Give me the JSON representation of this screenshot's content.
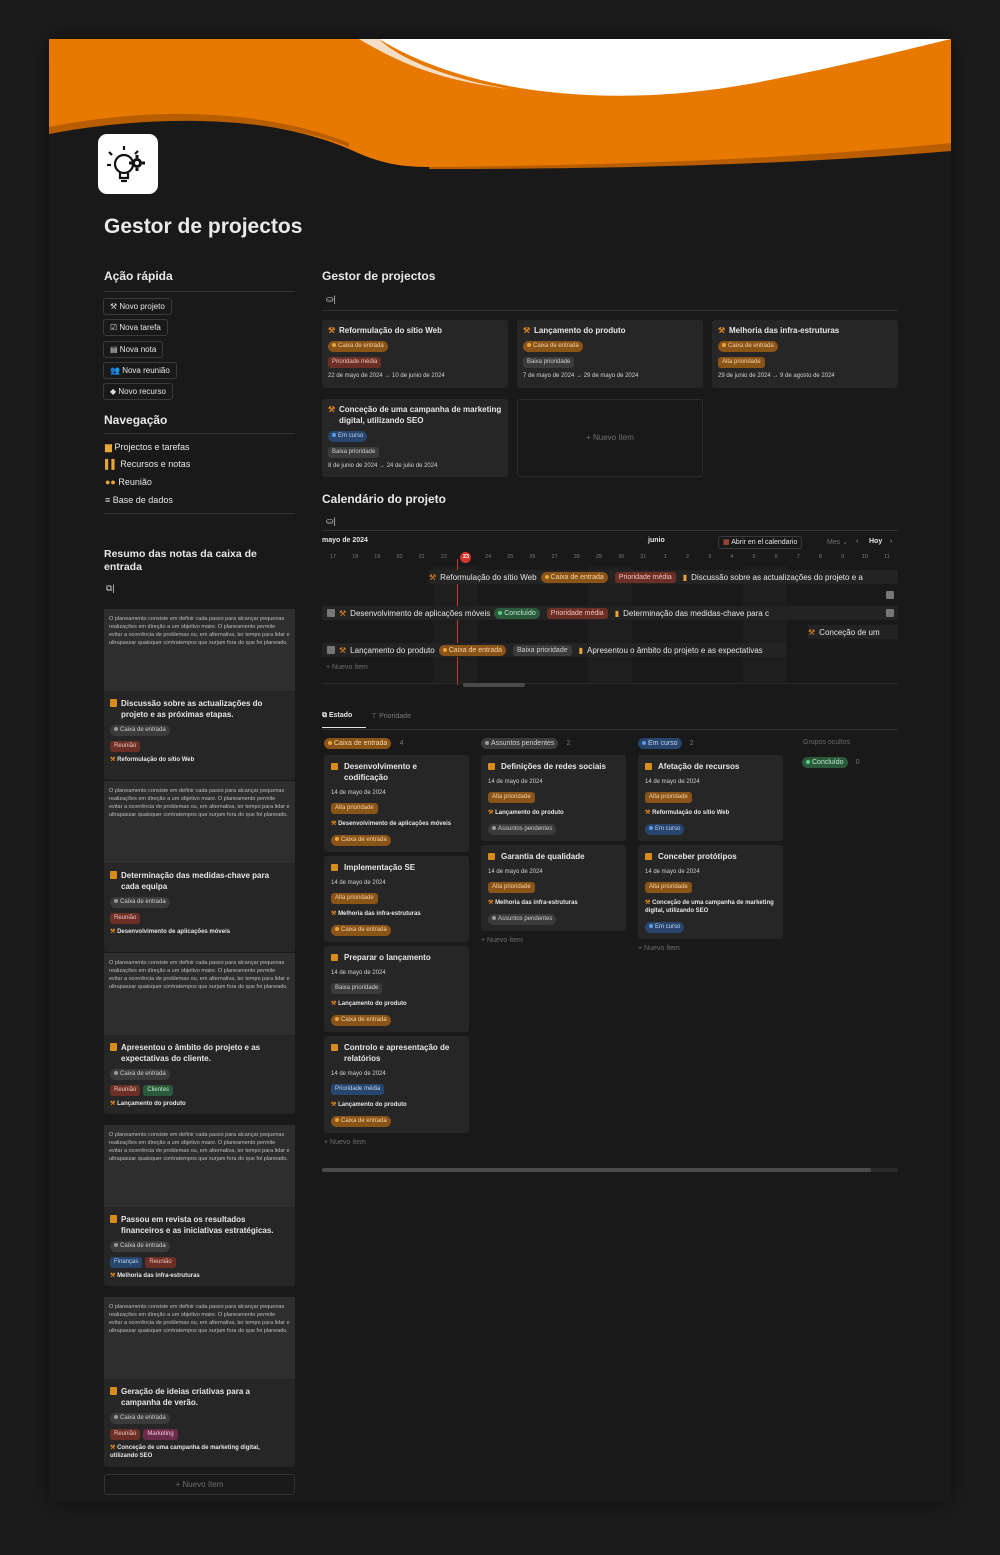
{
  "page": {
    "title": "Gestor de projectos"
  },
  "quick": {
    "heading": "Ação rápida",
    "buttons": [
      "Novo projeto",
      "Nova tarefa",
      "Nova nota",
      "Nova reunião",
      "Novo recurso"
    ]
  },
  "nav": {
    "heading": "Navegação",
    "items": [
      "Projectos e tarefas",
      "Recursos e notas",
      "Reunião",
      "Base de dados"
    ]
  },
  "inbox": {
    "heading": "Resumo das notas da caixa de entrada",
    "desc": "O planeamento consiste em definir cada passo para alcançar pequenas realizações em direção a um objetivo maior. O planeamento permite evitar a ocorrência de problemas ou, em alternativa, ter tempo para lidar e ultrapassar quaisquer contratempos que surjam fora do que foi planeado.",
    "cards": [
      {
        "title": "Discussão sobre as actualizações do projeto e as próximas etapas.",
        "status": "Caixa de entrada",
        "tags": [
          "Reunião"
        ],
        "project": "Reformulação do sítio Web"
      },
      {
        "title": "Determinação das medidas-chave para cada equipa",
        "status": "Caixa de entrada",
        "tags": [
          "Reunião"
        ],
        "project": "Desenvolvimento de aplicações móveis"
      },
      {
        "title": "Apresentou o âmbito do projeto e as expectativas do cliente.",
        "status": "Caixa de entrada",
        "tags": [
          "Reunião",
          "Clientes"
        ],
        "project": "Lançamento do produto"
      },
      {
        "title": "Passou em revista os resultados financeiros e as iniciativas estratégicas.",
        "status": "Caixa de entrada",
        "tags": [
          "Finanças",
          "Reunião"
        ],
        "project": "Melhoria das infra-estruturas"
      },
      {
        "title": "Geração de ideias criativas para a campanha de verão.",
        "status": "Caixa de entrada",
        "tags": [
          "Reunião",
          "Marketing"
        ],
        "project": "Conceção de uma campanha de marketing digital, utilizando SEO"
      }
    ],
    "new_item": "+ Nuevo ítem"
  },
  "gallery": {
    "heading": "Gestor de projectos",
    "cards": [
      {
        "title": "Reformulação do sítio Web",
        "status": "Caixa de entrada",
        "priority": "Prioridade média",
        "dates": "22 de mayo de 2024 → 10 de junio de 2024"
      },
      {
        "title": "Lançamento do produto",
        "status": "Caixa de entrada",
        "priority": "Baixa prioridade",
        "dates": "7 de mayo de 2024 → 29 de mayo de 2024"
      },
      {
        "title": "Melhoria das infra-estruturas",
        "status": "Caixa de entrada",
        "priority": "Alta prioridade",
        "dates": "29 de junio de 2024 → 9 de agosto de 2024"
      },
      {
        "title": "Conceção de uma campanha de marketing digital, utilizando SEO",
        "status": "Em curso",
        "priority": "Baixa prioridade",
        "dates": "8 de junio de 2024 → 24 de julio de 2024"
      }
    ],
    "new_item": "+ Nuevo ítem"
  },
  "calendar": {
    "heading": "Calendário do projeto",
    "month_left": "mayo de 2024",
    "month_right": "junio",
    "open_btn": "Abrir en el calendario",
    "mode": "Mes",
    "today": "Hoy",
    "days": [
      "17",
      "18",
      "19",
      "20",
      "21",
      "22",
      "23",
      "24",
      "25",
      "26",
      "27",
      "28",
      "29",
      "30",
      "31",
      "1",
      "2",
      "3",
      "4",
      "5",
      "6",
      "7",
      "8",
      "9",
      "10",
      "11"
    ],
    "today_day": "23",
    "rows": [
      {
        "project": "Reformulação do sítio Web",
        "status": "Caixa de entrada",
        "priority": "Prioridade média",
        "note": "Discussão sobre as actualizações do projeto e a"
      },
      {
        "project": "Desenvolvimento de aplicações móveis",
        "status": "Concluído",
        "priority": "Prioridade média",
        "note": "Determinação das medidas-chave para c"
      },
      {
        "project": "Conceção de um"
      },
      {
        "project": "Lançamento do produto",
        "status": "Caixa de entrada",
        "priority": "Baixa prioridade",
        "note": "Apresentou o âmbito do projeto e as expectativas"
      }
    ],
    "new_item": "+ Nuevo ítem"
  },
  "board": {
    "tabs": [
      "Estado",
      "Prioridade"
    ],
    "hidden_label": "Grupos ocultos",
    "hidden_group": {
      "name": "Concluído",
      "count": "0"
    },
    "columns": [
      {
        "name": "Caixa de entrada",
        "count": "4",
        "cards": [
          {
            "title": "Desenvolvimento e codificação",
            "date": "14 de mayo de 2024",
            "priority": "Alta prioridade",
            "project": "Desenvolvimento de aplicações móveis",
            "status": "Caixa de entrada"
          },
          {
            "title": "Implementação SE",
            "date": "14 de mayo de 2024",
            "priority": "Alta prioridade",
            "project": "Melhoria das infra-estruturas",
            "status": "Caixa de entrada"
          },
          {
            "title": "Preparar o lançamento",
            "date": "14 de mayo de 2024",
            "priority": "Baixa prioridade",
            "project": "Lançamento do produto",
            "status": "Caixa de entrada"
          },
          {
            "title": "Controlo e apresentação de relatórios",
            "date": "14 de mayo de 2024",
            "priority": "Prioridade média",
            "project": "Lançamento do produto",
            "status": "Caixa de entrada"
          }
        ]
      },
      {
        "name": "Assuntos pendentes",
        "count": "2",
        "cards": [
          {
            "title": "Definições de redes sociais",
            "date": "14 de mayo de 2024",
            "priority": "Alta prioridade",
            "project": "Lançamento do produto",
            "status": "Assuntos pendentes"
          },
          {
            "title": "Garantia de qualidade",
            "date": "14 de mayo de 2024",
            "priority": "Alta prioridade",
            "project": "Melhoria das infra-estruturas",
            "status": "Assuntos pendentes"
          }
        ]
      },
      {
        "name": "Em curso",
        "count": "2",
        "cards": [
          {
            "title": "Afetação de recursos",
            "date": "14 de mayo de 2024",
            "priority": "Alta prioridade",
            "project": "Reformulação do sítio Web",
            "status": "Em curso"
          },
          {
            "title": "Conceber protótipos",
            "date": "14 de mayo de 2024",
            "priority": "Alta prioridade",
            "project": "Conceção de uma campanha de marketing digital, utilizando SEO",
            "status": "Em curso"
          }
        ]
      }
    ],
    "new_item": "+ Nuevo ítem"
  },
  "colors": {
    "accent": "#e57a00",
    "background": "#191919",
    "card": "#262626"
  }
}
